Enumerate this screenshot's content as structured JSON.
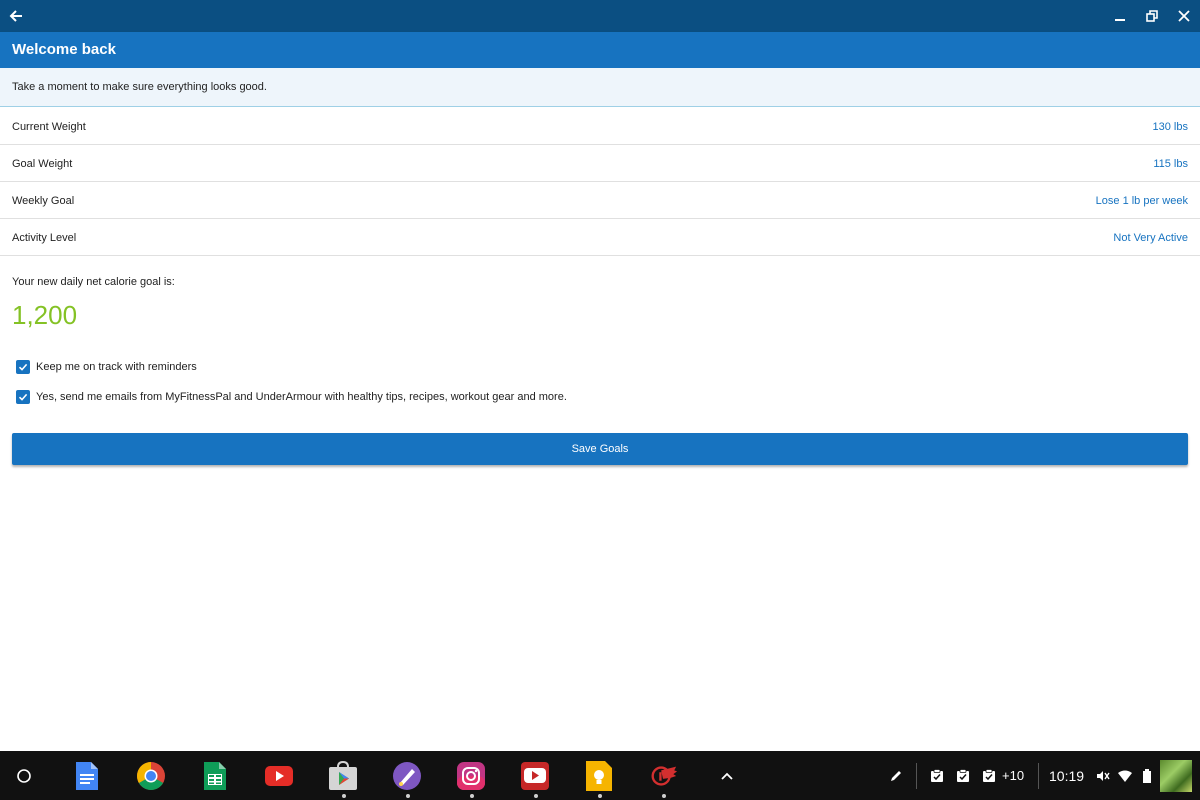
{
  "window": {
    "back_icon": "arrow-left-icon",
    "minimize_icon": "minimize-icon",
    "restore_icon": "restore-icon",
    "close_icon": "close-icon",
    "color": "#0b4f82"
  },
  "app_bar": {
    "title": "Welcome back",
    "color": "#1773c0"
  },
  "info_banner": {
    "text": "Take a moment to make sure everything looks good."
  },
  "goal_rows": [
    {
      "label": "Current Weight",
      "value": "130 lbs"
    },
    {
      "label": "Goal Weight",
      "value": "115 lbs"
    },
    {
      "label": "Weekly Goal",
      "value": "Lose 1 lb per week"
    },
    {
      "label": "Activity Level",
      "value": "Not Very Active"
    }
  ],
  "calorie_goal": {
    "label": "Your new daily net calorie goal is:",
    "value": "1,200",
    "color": "#84c225"
  },
  "checkboxes": [
    {
      "label": "Keep me on track with reminders",
      "checked": true
    },
    {
      "label": "Yes, send me emails from MyFitnessPal and UnderArmour with healthy tips, recipes, workout gear and more.",
      "checked": true
    }
  ],
  "save_button": {
    "label": "Save Goals"
  },
  "shelf": {
    "launcher_icon": "launcher-circle-icon",
    "apps": [
      {
        "icon": "google-docs-icon",
        "running": false
      },
      {
        "icon": "chrome-icon",
        "running": false
      },
      {
        "icon": "google-sheets-icon",
        "running": false
      },
      {
        "icon": "youtube-icon",
        "running": false
      },
      {
        "icon": "play-store-icon",
        "running": true
      },
      {
        "icon": "drawing-app-icon",
        "running": true
      },
      {
        "icon": "instagram-icon",
        "running": true
      },
      {
        "icon": "youtube-app-icon",
        "running": true
      },
      {
        "icon": "google-keep-icon",
        "running": true
      },
      {
        "icon": "red-wings-icon",
        "running": true
      }
    ],
    "expand_icon": "chevron-up-icon",
    "status": {
      "stylus_icon": "stylus-icon",
      "notification_icons": [
        "clipboard-check-icon",
        "clipboard-check-icon",
        "clipboard-check-icon"
      ],
      "notification_count": "+10",
      "time": "10:19",
      "mute_icon": "volume-mute-icon",
      "wifi_icon": "wifi-icon",
      "battery_icon": "battery-icon",
      "avatar": "user-avatar"
    }
  }
}
